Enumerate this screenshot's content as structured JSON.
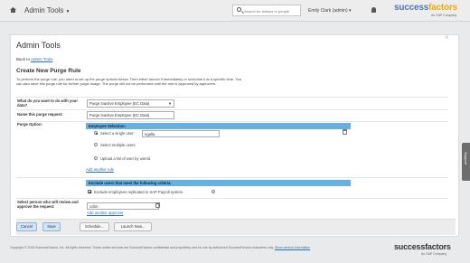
{
  "header": {
    "module_label": "Admin Tools",
    "search_placeholder": "Search for actions or people",
    "user_name": "Emily Clark (admin)",
    "logo_part1": "success",
    "logo_part2": "factors",
    "logo_sub": "An SAP Company"
  },
  "page": {
    "title": "Admin Tools",
    "back_prefix": "Back to",
    "back_link": "Admin Tools",
    "heading": "Create New Purge Rule",
    "intro": "To perform the purge rule, you need to set up the purge options below. Then either launch it immediately or schedule it at a specific time. You can also save this purge rule for further purge usage. The purge will not be performed until the rule is approved by approvers."
  },
  "form": {
    "q_purge_label": "What do you want to do with your data?",
    "q_purge_value": "Purge Inactive Employee (EC Data)",
    "q_name_label": "Name this purge request:",
    "q_name_value": "Purge Inactive Employee (EC Data)",
    "purge_option_label": "Purge Option:",
    "employee_selection_title": "Employee Selection:",
    "radio_single": "Select a single user:",
    "single_user_value": "ngalla",
    "radio_multiple": "Select multiple users",
    "radio_upload": "Upload a list of user by userid",
    "add_another_rule": "Add another rule",
    "exclude_title": "Exclude users that meet the following criteria:",
    "exclude_checkbox": "Exclude employees replicated to SAP Payroll system.",
    "approver_label": "Select person who will review and approve the request:",
    "approver_value": "cclim",
    "add_another_approver": "Add another approver"
  },
  "buttons": {
    "cancel": "Cancel",
    "save": "Save",
    "schedule": "Schedule...",
    "launch_now": "Launch Now..."
  },
  "footer": {
    "copyright": "Copyright © 2015 SuccessFactors, Inc. All rights reserved. These online services are SuccessFactors confidential and proprietary and for use by authorized SuccessFactors customers only.",
    "support_link": "Show version information",
    "logo_text": "successfactors",
    "logo_sub": "An SAP Company",
    "support_tab": "Support"
  }
}
